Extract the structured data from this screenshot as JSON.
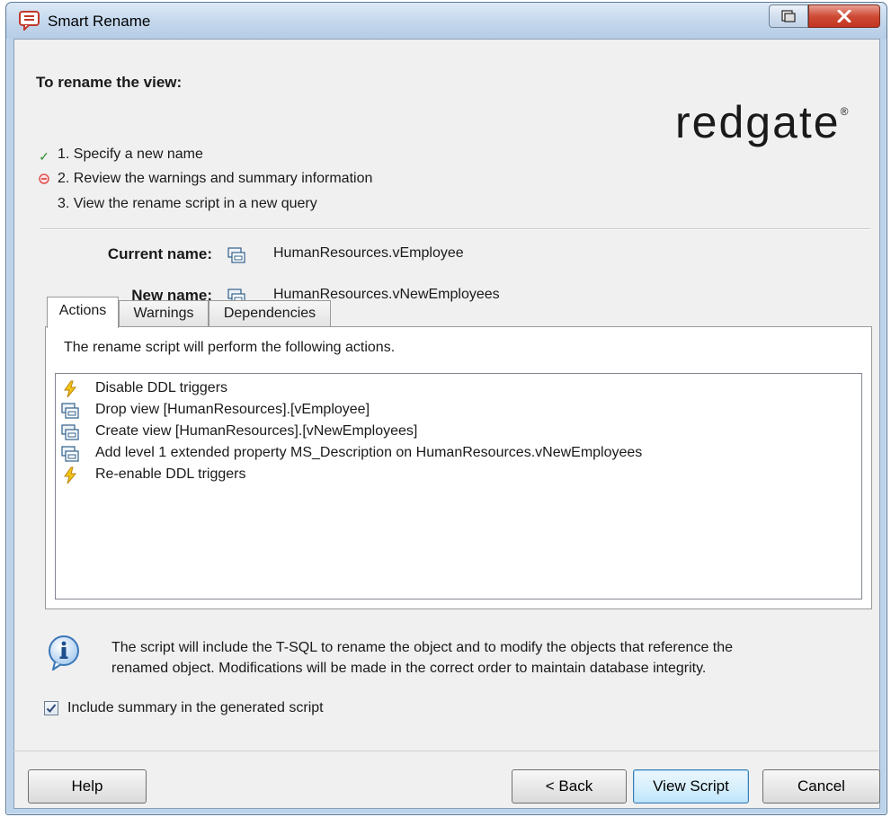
{
  "window": {
    "title": "Smart Rename",
    "app_icon": "dialog-icon"
  },
  "wizard": {
    "heading": "To rename the view:",
    "steps": [
      {
        "label": "1. Specify a new name",
        "status_icon": "check-icon",
        "color": "#2e8b2e"
      },
      {
        "label": "2. Review the warnings and summary information",
        "status_icon": "current-step-icon",
        "color": "#e05050"
      },
      {
        "label": "3. View the rename script in a new query",
        "status_icon": ""
      }
    ]
  },
  "brand": {
    "logo_text": "redgate",
    "registered": "®"
  },
  "names": {
    "current_label": "Current name:",
    "current_value": "HumanResources.vEmployee",
    "new_label": "New name:",
    "new_value": "HumanResources.vNewEmployees"
  },
  "tabs": [
    {
      "label": "Actions",
      "active": true
    },
    {
      "label": "Warnings",
      "active": false
    },
    {
      "label": "Dependencies",
      "active": false
    }
  ],
  "actions_panel": {
    "intro": "The rename script will perform the following actions.",
    "items": [
      {
        "icon": "lightning-icon",
        "text": "Disable DDL triggers"
      },
      {
        "icon": "view-icon",
        "text": "Drop view [HumanResources].[vEmployee]"
      },
      {
        "icon": "view-icon",
        "text": "Create view [HumanResources].[vNewEmployees]"
      },
      {
        "icon": "view-icon",
        "text": "Add level 1 extended property MS_Description on HumanResources.vNewEmployees"
      },
      {
        "icon": "lightning-icon",
        "text": "Re-enable DDL triggers"
      }
    ]
  },
  "info": {
    "icon": "info-icon",
    "line1": "The script will include the T-SQL to rename the object and to modify the objects that reference the",
    "line2": "renamed object. Modifications will be made in the correct order to maintain database integrity."
  },
  "summary_checkbox": {
    "label": "Include summary in the generated script",
    "checked": true
  },
  "buttons": {
    "help": "Help",
    "back": "< Back",
    "view_script": "View Script",
    "cancel": "Cancel"
  },
  "colors": {
    "title_bar": "#c3d7ec",
    "close_button": "#c7432e",
    "accent": "#3c7fb1"
  }
}
